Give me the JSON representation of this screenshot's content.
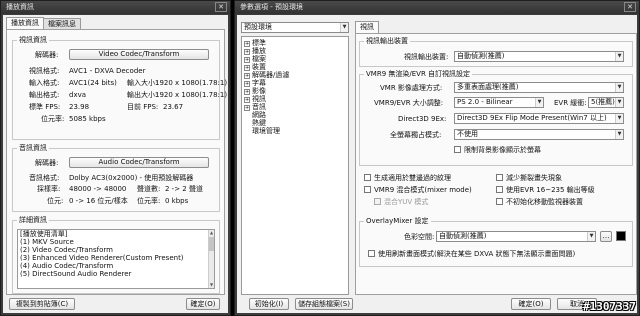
{
  "left_window": {
    "title": "播放資訊",
    "tabs": [
      "播放資訊",
      "檔案訊息"
    ],
    "video": {
      "group_title": "視訊資訊",
      "decoder_label": "解碼器:",
      "decoder_button": "Video Codec/Transform",
      "format_label": "視訊格式:",
      "format_value": "AVC1 - DXVA Decoder",
      "input_format_label": "輸入格式:",
      "input_format_value": "AVC1(24 bits)",
      "input_size_label": "輸入大小:",
      "input_size_value": "1920 x 1080(1.78:1)",
      "output_format_label": "輸出格式:",
      "output_format_value": "dxva",
      "output_size_label": "輸出大小:",
      "output_size_value": "1920 x 1080(1.78:1)",
      "std_fps_label": "標準 FPS:",
      "std_fps_value": "23.98",
      "cur_fps_label": "目前 FPS:",
      "cur_fps_value": "23.67",
      "bitrate_label": "位元率:",
      "bitrate_value": "5085 kbps"
    },
    "audio": {
      "group_title": "音訊資訊",
      "decoder_label": "解碼器:",
      "decoder_button": "Audio Codec/Transform",
      "format_label": "音訊格式:",
      "format_value": "Dolby AC3(0x2000) - 使用預設解碼器",
      "sample_rate_label": "採樣率:",
      "sample_rate_value": "48000 -> 48000",
      "channels_label": "聲道數:",
      "channels_value": "2 -> 2 聲道",
      "bits_label": "位元:",
      "bits_value": "0 -> 16 位元/樣本",
      "bitrate_label": "位元率:",
      "bitrate_value": "0 kbps"
    },
    "details": {
      "group_title": "詳細資訊",
      "lines": [
        "[播放使用清單]",
        "(1) MKV Source",
        "(2) Video Codec/Transform",
        "(3) Enhanced Video Renderer(Custom Present)",
        "(4) Audio Codec/Transform",
        "(5) DirectSound Audio Renderer"
      ]
    },
    "copy_button": "複製到剪貼簿(C)",
    "ok_button": "確定(O)"
  },
  "right_window": {
    "title": "參數選項 - 預設環境",
    "profile_select": "預設環境",
    "tree": [
      {
        "label": "標準",
        "expandable": true
      },
      {
        "label": "播放",
        "expandable": true
      },
      {
        "label": "檔案",
        "expandable": true
      },
      {
        "label": "裝置",
        "expandable": true
      },
      {
        "label": "解碼器/過濾",
        "expandable": true
      },
      {
        "label": "字幕",
        "expandable": true
      },
      {
        "label": "影像",
        "expandable": true
      },
      {
        "label": "視訊",
        "expandable": true
      },
      {
        "label": "音訊",
        "expandable": true
      },
      {
        "label": "網路",
        "expandable": false
      },
      {
        "label": "熱鍵",
        "expandable": false
      },
      {
        "label": "環境管理",
        "expandable": false
      }
    ],
    "tab": "視訊",
    "output_group": {
      "title": "視訊輸出裝置",
      "device_label": "視訊輸出裝置:",
      "device_value": "自動偵測(推薦)"
    },
    "vmr_group": {
      "title": "VMR9 無渲染/EVR 自訂視訊設定",
      "mode_label": "VMR 影像處理方式:",
      "mode_value": "多重表面處理(推薦)",
      "resize_label": "VMR9/EVR 大小調整:",
      "resize_value": "PS 2.0 - Bilinear",
      "evr_buffer_label": "EVR 緩衝:",
      "evr_buffer_value": "5(推薦)",
      "d3d_label": "Direct3D 9Ex:",
      "d3d_value": "Direct3D 9Ex Flip Mode Present(Win7 以上)",
      "fullscreen_label": "全螢幕獨占模式:",
      "fullscreen_value": "不使用",
      "limit_check": "限制背景影像顯示於螢幕"
    },
    "checks": {
      "gen_tex": "生成適用於雙邊過的紋理",
      "mixer": "VMR9 混合模式(mixer mode)",
      "mixer_yuv": "混合YUV 模式",
      "reduce_tearing": "減少撕裂畫失現象",
      "evr_range": "使用EVR 16~235 輸出等級",
      "no_aero": "不初始化移動監視器裝置"
    },
    "overlay_group": {
      "title": "OverlayMixer 設定",
      "color_label": "色彩空間:",
      "color_value": "自動偵測(推薦)",
      "refresh_check": "使用刷新畫面模式(解決在某些 DXVA 狀態下無法顯示畫面問題)"
    },
    "init_button": "初始化(I)",
    "save_button": "儲存組態檔案(S)",
    "ok_button": "確定(O)",
    "cancel_button": "取消"
  },
  "watermark": "#1307337"
}
